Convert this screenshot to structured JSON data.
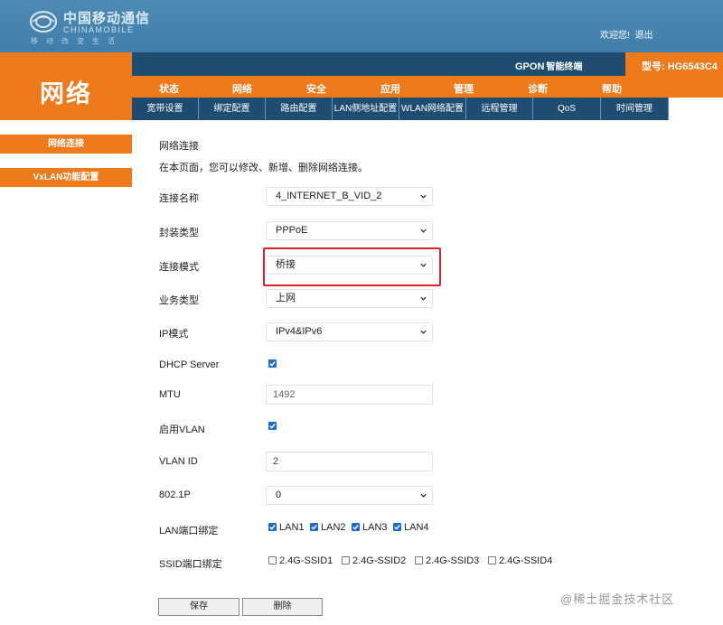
{
  "header": {
    "logo_cn": "中国移动通信",
    "logo_en": "CHINAMOBILE",
    "logo_sub": "移动改变生活",
    "welcome": "欢迎您!",
    "logout": "退出"
  },
  "left_title": "网络",
  "infobar": {
    "gpon": "GPON",
    "terminal": "智能终端",
    "model_label": "型号:",
    "model_value": "HG6543C4"
  },
  "mainnav": [
    "状态",
    "网络",
    "安全",
    "应用",
    "管理",
    "诊断",
    "帮助"
  ],
  "subnav": [
    "宽带设置",
    "绑定配置",
    "路由配置",
    "LAN侧地址配置",
    "WLAN网络配置",
    "远程管理",
    "QoS",
    "时间管理"
  ],
  "sidebar": [
    "网络连接",
    "VxLAN功能配置"
  ],
  "content": {
    "title": "网络连接",
    "description": "在本页面，您可以修改、新增、删除网络连接。",
    "fields": {
      "conn_name": {
        "label": "连接名称",
        "value": "4_INTERNET_B_VID_2"
      },
      "encap": {
        "label": "封装类型",
        "value": "PPPoE"
      },
      "mode": {
        "label": "连接模式",
        "value": "桥接"
      },
      "service": {
        "label": "业务类型",
        "value": "上网"
      },
      "ip_mode": {
        "label": "IP模式",
        "value": "IPv4&IPv6"
      },
      "dhcp": {
        "label": "DHCP Server",
        "checked": true
      },
      "mtu": {
        "label": "MTU",
        "placeholder": "1492"
      },
      "vlan_enable": {
        "label": "启用VLAN",
        "checked": true
      },
      "vlan_id": {
        "label": "VLAN ID",
        "value": "2"
      },
      "dot1p": {
        "label": "802.1P",
        "value": "0"
      },
      "lan_bind": {
        "label": "LAN端口绑定",
        "options": [
          {
            "name": "LAN1",
            "checked": true
          },
          {
            "name": "LAN2",
            "checked": true
          },
          {
            "name": "LAN3",
            "checked": true
          },
          {
            "name": "LAN4",
            "checked": true
          }
        ]
      },
      "ssid_bind": {
        "label": "SSID端口绑定",
        "options": [
          {
            "name": "2.4G-SSID1",
            "checked": false
          },
          {
            "name": "2.4G-SSID2",
            "checked": false
          },
          {
            "name": "2.4G-SSID3",
            "checked": false
          },
          {
            "name": "2.4G-SSID4",
            "checked": false
          }
        ]
      }
    },
    "save": "保存",
    "delete": "删除"
  },
  "watermark": "@稀土掘金技术社区",
  "colors": {
    "orange": "#ee7a1c",
    "navy": "#1f4d72",
    "header_blue": "#4482ad",
    "checkbox_blue": "#1b6ad6",
    "highlight_red": "#d9232b"
  }
}
